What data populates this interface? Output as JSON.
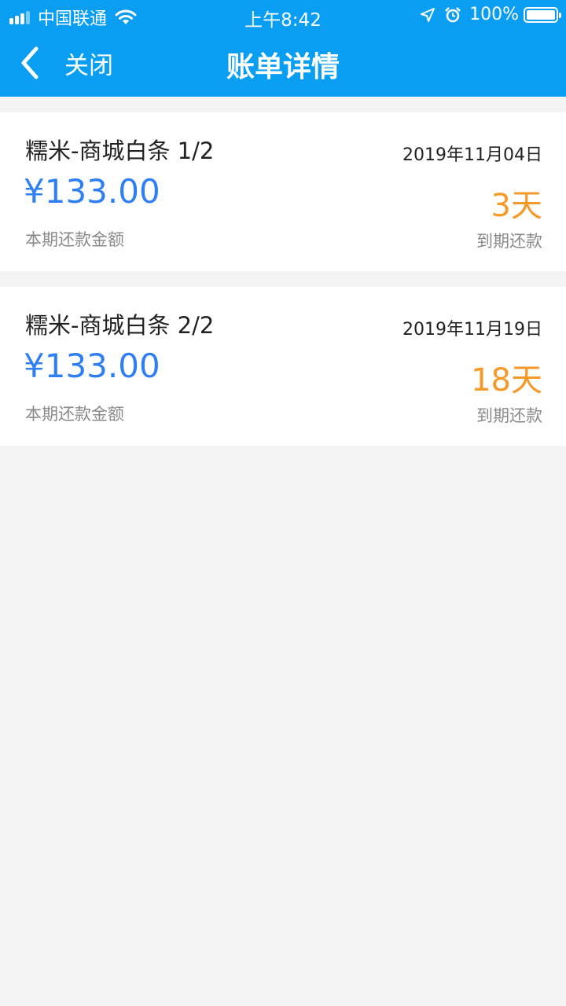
{
  "status_bar": {
    "carrier": "中国联通",
    "time": "上午8:42",
    "battery": "100%"
  },
  "nav": {
    "back_label": "关闭",
    "title": "账单详情"
  },
  "bills": [
    {
      "name": "糯米-商城白条 1/2",
      "date": "2019年11月04日",
      "amount": "¥133.00",
      "amount_label": "本期还款金额",
      "days": "3天",
      "days_label": "到期还款"
    },
    {
      "name": "糯米-商城白条 2/2",
      "date": "2019年11月19日",
      "amount": "¥133.00",
      "amount_label": "本期还款金额",
      "days": "18天",
      "days_label": "到期还款"
    }
  ],
  "colors": {
    "header": "#0a9ef2",
    "amount": "#2f7ff3",
    "days": "#f39a2b",
    "page_bg": "#f3f3f3"
  }
}
